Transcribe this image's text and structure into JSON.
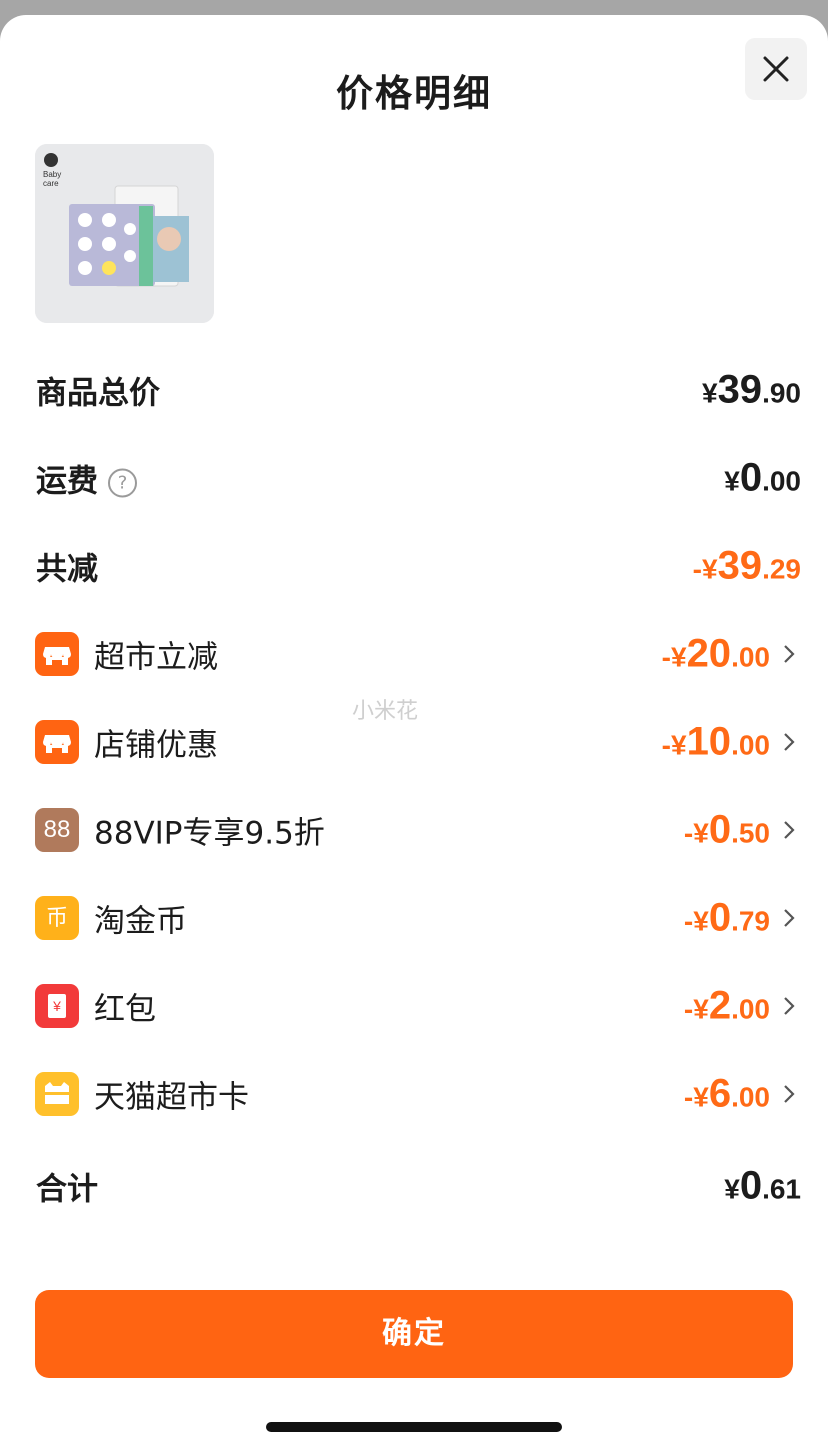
{
  "header": {
    "title": "价格明细"
  },
  "watermark": "小米花",
  "rows": {
    "total_goods": {
      "label": "商品总价",
      "yen": "¥",
      "int": "39",
      "dec": ".90"
    },
    "shipping": {
      "label": "运费",
      "help_icon": "question-circle-icon",
      "help_glyph": "?",
      "yen": "¥",
      "int": "0",
      "dec": ".00"
    },
    "total_discount": {
      "label": "共减",
      "yen": "-¥",
      "int": "39",
      "dec": ".29"
    },
    "discounts": [
      {
        "label": "超市立减",
        "icon": "supermarket-shop-icon",
        "yen": "-¥",
        "int": "20",
        "dec": ".00"
      },
      {
        "label": "店铺优惠",
        "icon": "store-shop-icon",
        "yen": "-¥",
        "int": "10",
        "dec": ".00"
      },
      {
        "label": "88VIP专享9.5折",
        "icon": "vip88-icon",
        "icon_text": "88",
        "yen": "-¥",
        "int": "0",
        "dec": ".50"
      },
      {
        "label": "淘金币",
        "icon": "taojinbi-coin-icon",
        "icon_text": "币",
        "yen": "-¥",
        "int": "0",
        "dec": ".79"
      },
      {
        "label": "红包",
        "icon": "red-envelope-icon",
        "icon_text": "¥",
        "yen": "-¥",
        "int": "2",
        "dec": ".00"
      },
      {
        "label": "天猫超市卡",
        "icon": "tmall-card-icon",
        "yen": "-¥",
        "int": "6",
        "dec": ".00"
      }
    ],
    "grand_total": {
      "label": "合计",
      "yen": "¥",
      "int": "0",
      "dec": ".61"
    }
  },
  "footer": {
    "confirm_label": "确定"
  },
  "colors": {
    "accent": "#ff6412",
    "discount": "#ff6a16",
    "vip": "#b07a5c",
    "coin": "#ffb11a",
    "red": "#f23a3a",
    "card": "#ffc02b"
  },
  "product": {
    "brand_lines": [
      "Baby",
      "care"
    ]
  }
}
